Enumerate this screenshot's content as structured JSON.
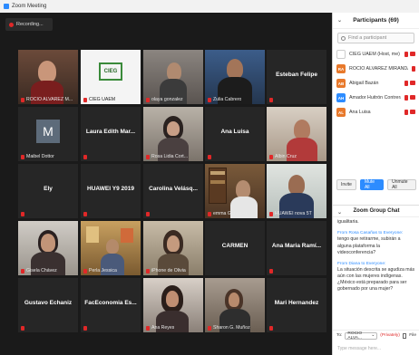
{
  "window": {
    "title": "Zoom Meeting"
  },
  "recording": {
    "label": "Recording..."
  },
  "tiles": [
    {
      "name": "ROCIO ALVAREZ M...",
      "center": ""
    },
    {
      "name": "CIEG UAEM",
      "center": ""
    },
    {
      "name": "olaya gonzalez",
      "center": ""
    },
    {
      "name": "Zulia Cabrero",
      "center": ""
    },
    {
      "name": "",
      "center": "Esteban Felipe"
    },
    {
      "name": "Maibel Dottor",
      "center": ""
    },
    {
      "name": "",
      "center": "Laura Edith Mar..."
    },
    {
      "name": "Rosa Lidia Cort...",
      "center": ""
    },
    {
      "name": "",
      "center": "Ana Luisa"
    },
    {
      "name": "Albin Cruz",
      "center": ""
    },
    {
      "name": "",
      "center": "Ely"
    },
    {
      "name": "",
      "center": "HUAWEI Y9 2019"
    },
    {
      "name": "",
      "center": "Carolina Velásq..."
    },
    {
      "name": "emma Gonzalez",
      "center": ""
    },
    {
      "name": "HUAWEI nova 5T",
      "center": ""
    },
    {
      "name": "Gisela Chávez",
      "center": ""
    },
    {
      "name": "Perla Jessica",
      "center": ""
    },
    {
      "name": "iPhone de Olivia",
      "center": ""
    },
    {
      "name": "",
      "center": "CARMEN"
    },
    {
      "name": "",
      "center": "Ana Maria Ramí..."
    },
    {
      "name": "",
      "center": "Gustavo Echaniz"
    },
    {
      "name": "",
      "center": "FacEconomia Es..."
    },
    {
      "name": "Ana Reyes",
      "center": ""
    },
    {
      "name": "Sharon G. Muñoz",
      "center": ""
    },
    {
      "name": "",
      "center": "Mari Hernandez"
    }
  ],
  "tile_monogram": "M",
  "cieg_logo_text": "CIEG",
  "participants": {
    "title": "Participants (69)",
    "search_placeholder": "Find a participant",
    "list": [
      {
        "initials": "",
        "name": "CIEG UAEM (Host, me)",
        "color": "#ffffff"
      },
      {
        "initials": "RA",
        "name": "ROCIO ALVAREZ MIRANDA",
        "color": "#e8792b"
      },
      {
        "initials": "AB",
        "name": "Abigail Bazán",
        "color": "#e8792b"
      },
      {
        "initials": "AH",
        "name": "Amador Huitrón Contreras",
        "color": "#2d8cff"
      },
      {
        "initials": "AL",
        "name": "Ana Luisa",
        "color": "#e8792b"
      }
    ],
    "invite_label": "Invite",
    "mute_all_label": "Mute All",
    "unmute_all_label": "Unmute All"
  },
  "chat": {
    "title": "Zoom Group Chat",
    "messages": [
      {
        "from": "",
        "to": "",
        "text": "igualitaria."
      },
      {
        "from": "From Rosa Casañas",
        "to": " to Everyone:",
        "text": "tengo que retirarme, subirán a alguna plataforma la videoconferencia?"
      },
      {
        "from": "From Diana",
        "to": " to Everyone:",
        "text": "La situación descrita se agudiza más aún con las mujeres indígenas. ¿México está preparado para ser gobernado por una mujer?"
      }
    ],
    "to_label": "To:",
    "to_value": "ROCIO ALVA...",
    "private_label": "(Privately)",
    "file_label": "File",
    "input_placeholder": "Type message here..."
  }
}
